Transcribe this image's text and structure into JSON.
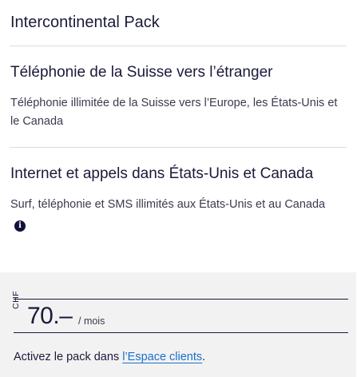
{
  "pack": {
    "title": "Intercontinental Pack"
  },
  "sections": [
    {
      "title": "Téléphonie de la Suisse vers l’étranger",
      "description": "Téléphonie illimitée de la Suisse vers l’Europe, les États-Unis et le Canada"
    },
    {
      "title": "Internet et appels dans États-Unis et Canada",
      "description": "Surf, téléphonie et SMS illimités aux États-Unis et au Canada"
    }
  ],
  "icons": {
    "info": "info-icon"
  },
  "price": {
    "currency": "CHF",
    "amount": "70.–",
    "period": "/ mois"
  },
  "activation": {
    "text_before": "Activez le pack dans ",
    "link_text": "l’Espace clients",
    "text_after": "."
  },
  "colors": {
    "text": "#1a1a3a",
    "link": "#1a6fc9",
    "footer_bg": "#f2f2f3"
  }
}
